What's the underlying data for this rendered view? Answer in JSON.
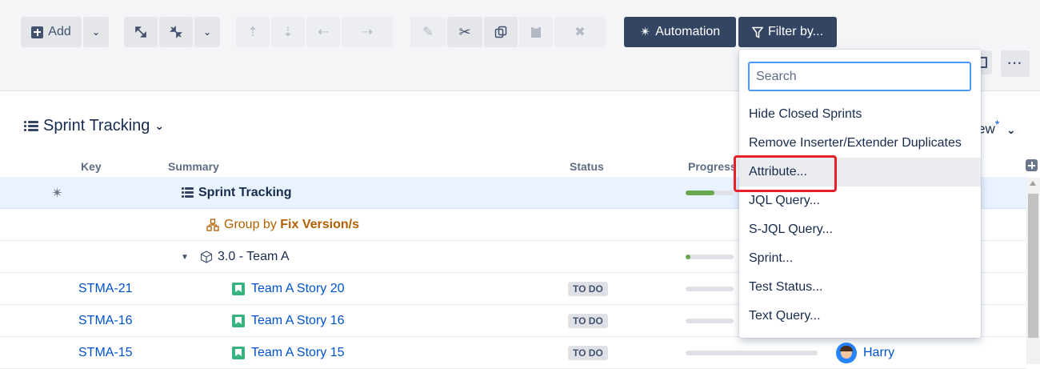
{
  "toolbar": {
    "add_label": "Add",
    "automation_label": "Automation",
    "filter_label": "Filter by..."
  },
  "structure": {
    "title": "Sprint Tracking",
    "view_label": "ew",
    "view_modified": "*"
  },
  "grid": {
    "columns": {
      "key": "Key",
      "summary": "Summary",
      "status": "Status",
      "progress": "Progress"
    },
    "rows": [
      {
        "key": "",
        "summary": "Sprint Tracking",
        "status": "",
        "progress": 0.6
      },
      {
        "key": "",
        "summary_prefix": "Group by ",
        "summary": "Fix Version/s",
        "status": ""
      },
      {
        "key": "",
        "summary": "3.0 - Team A",
        "status": "",
        "progress": 0.05
      },
      {
        "key": "STMA-21",
        "summary": "Team A Story 20",
        "status": "TO DO",
        "progress": 0
      },
      {
        "key": "STMA-16",
        "summary": "Team A Story 16",
        "status": "TO DO",
        "progress": 0
      },
      {
        "key": "STMA-15",
        "summary": "Team A Story 15",
        "status": "TO DO",
        "progress": 0,
        "assignee": "Harry"
      }
    ]
  },
  "filter_menu": {
    "search_placeholder": "Search",
    "items": [
      "Hide Closed Sprints",
      "Remove Inserter/Extender Duplicates",
      "Attribute...",
      "JQL Query...",
      "S-JQL Query...",
      "Sprint...",
      "Test Status...",
      "Text Query..."
    ],
    "highlighted_item": "Attribute..."
  },
  "colors": {
    "accent": "#0052cc",
    "dark_button": "#344563",
    "highlight_red": "#e8202a",
    "progress_green": "#6aa84f",
    "group_orange": "#b25f00"
  },
  "icons": [
    "add-icon",
    "chevron-down-icon",
    "expand-icon",
    "collapse-icon",
    "move-up-icon",
    "move-down-icon",
    "move-left-icon",
    "move-right-icon",
    "edit-icon",
    "cut-icon",
    "copy-icon",
    "paste-icon",
    "delete-icon",
    "automation-wand-icon",
    "filter-icon",
    "structure-icon",
    "story-icon",
    "group-icon",
    "version-icon",
    "user-avatar"
  ]
}
